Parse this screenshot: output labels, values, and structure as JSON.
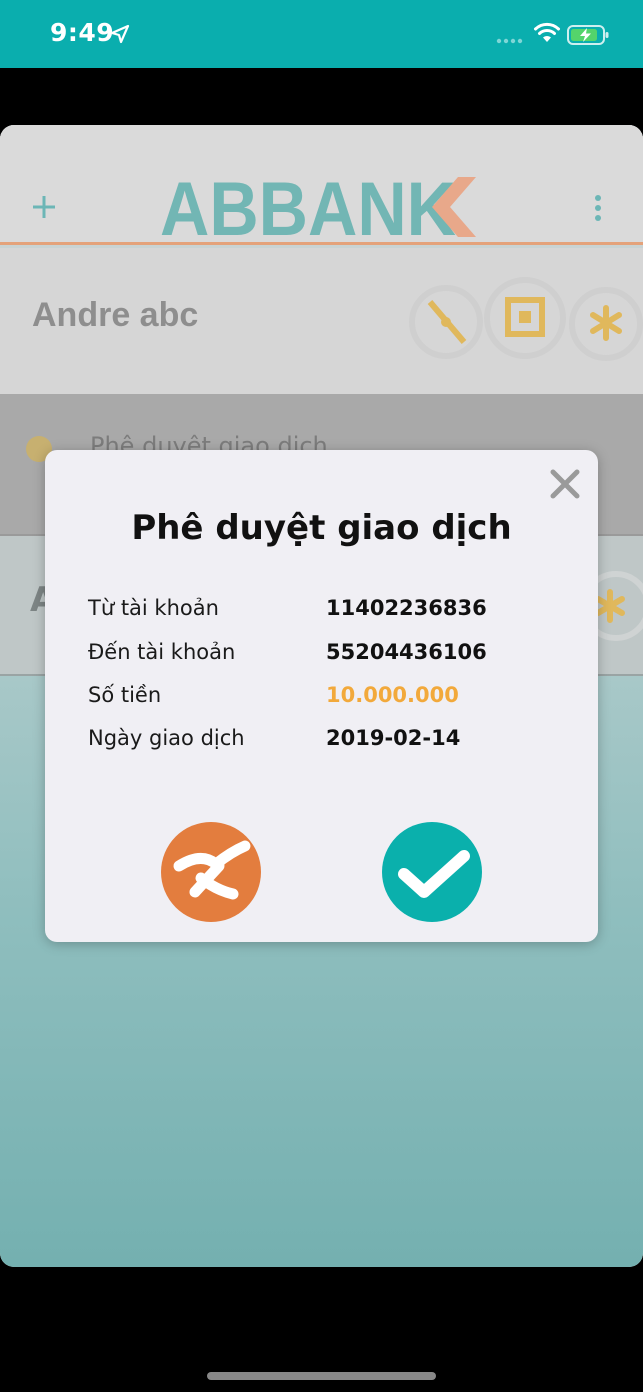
{
  "status_bar": {
    "time": "9:49",
    "icons": [
      "location-arrow-icon",
      "signal-dots-icon",
      "wifi-icon",
      "battery-charging-icon"
    ]
  },
  "header": {
    "brand": "ABBANK",
    "brand_color": "#0aaeae",
    "accent_color": "#e4a27a"
  },
  "user": {
    "name": "Andre abc"
  },
  "pending": {
    "label": "Phê duyệt giao dịch"
  },
  "account_row": {
    "initial": "A"
  },
  "dialog": {
    "title": "Phê duyệt giao dịch",
    "rows": [
      {
        "label": "Từ tài khoản",
        "value": "11402236836"
      },
      {
        "label": "Đến tài khoản",
        "value": "55204436106"
      },
      {
        "label": "Số tiền",
        "value": "10.000.000"
      },
      {
        "label": "Ngày giao dịch",
        "value": "2019-02-14"
      }
    ],
    "amount_color": "#f2a93b",
    "reject_color": "#e37d3e",
    "approve_color": "#0ab0ac"
  }
}
